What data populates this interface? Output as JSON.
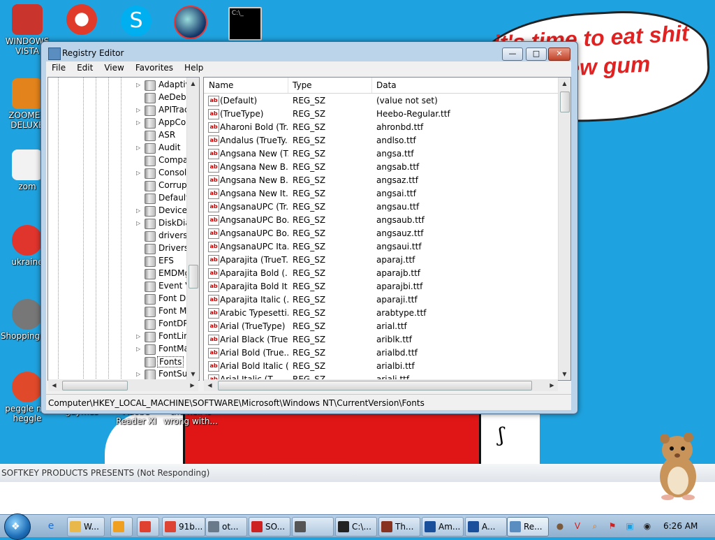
{
  "speech_bubble": {
    "text": "it's time to eat shit and chew gum"
  },
  "desktop_icons": [
    {
      "label": "WINDOWS VISTA",
      "color": "#c9342d",
      "icon": "windows-vista-icon"
    },
    {
      "label": "ZOOMER DELUXE",
      "color": "#e3831b",
      "icon": "zoomer-icon"
    },
    {
      "label": "zom",
      "color": "#f2f2f2",
      "icon": "flower-icon"
    },
    {
      "label": "ukraine",
      "color": "#e0352d",
      "icon": "radiation-icon"
    },
    {
      "label": "ShoppingC...",
      "color": "#777777",
      "icon": "flash-icon"
    },
    {
      "label": "peggle my heggle",
      "color": "#e04a2a",
      "icon": "peggle-icon"
    },
    {
      "label": "gaymes",
      "color": "#ffffff",
      "icon": "folder-icon"
    },
    {
      "label": "Adobe Reader XI",
      "color": "#ffffff",
      "icon": "adobe-icon"
    },
    {
      "label": "the hell is wrong with...",
      "color": "#ffffff",
      "icon": "file-icon"
    }
  ],
  "top_icons": [
    "peggle-icon",
    "skype-icon",
    "globe-icon",
    "cmd-icon"
  ],
  "window": {
    "title": "Registry Editor",
    "controls": {
      "minimize": "—",
      "maximize": "□",
      "close": "✕"
    },
    "menu": [
      "File",
      "Edit",
      "View",
      "Favorites",
      "Help"
    ],
    "tree": [
      {
        "label": "Adaptiv",
        "expander": "▷"
      },
      {
        "label": "AeDebu",
        "expander": ""
      },
      {
        "label": "APITrac",
        "expander": "▷"
      },
      {
        "label": "AppCo",
        "expander": "▷"
      },
      {
        "label": "ASR",
        "expander": ""
      },
      {
        "label": "Audit",
        "expander": "▷"
      },
      {
        "label": "Compa",
        "expander": ""
      },
      {
        "label": "Consol",
        "expander": "▷"
      },
      {
        "label": "Corrupt",
        "expander": ""
      },
      {
        "label": "Default",
        "expander": ""
      },
      {
        "label": "DeviceD",
        "expander": "▷"
      },
      {
        "label": "DiskDia",
        "expander": "▷"
      },
      {
        "label": "drivers.",
        "expander": ""
      },
      {
        "label": "Drivers3",
        "expander": ""
      },
      {
        "label": "EFS",
        "expander": ""
      },
      {
        "label": "EMDMg",
        "expander": ""
      },
      {
        "label": "Event V",
        "expander": ""
      },
      {
        "label": "Font Dr",
        "expander": ""
      },
      {
        "label": "Font M",
        "expander": ""
      },
      {
        "label": "FontDP",
        "expander": ""
      },
      {
        "label": "FontLin",
        "expander": "▷"
      },
      {
        "label": "FontMa",
        "expander": "▷"
      },
      {
        "label": "Fonts",
        "expander": "",
        "selected": true
      },
      {
        "label": "FontSu",
        "expander": "▷"
      }
    ],
    "columns": [
      "Name",
      "Type",
      "Data"
    ],
    "values": [
      {
        "name": "(Default)",
        "type": "REG_SZ",
        "data": "(value not set)"
      },
      {
        "name": "(TrueType)",
        "type": "REG_SZ",
        "data": "Heebo-Regular.ttf"
      },
      {
        "name": "Aharoni Bold (Tr...",
        "type": "REG_SZ",
        "data": "ahronbd.ttf"
      },
      {
        "name": "Andalus (TrueTy...",
        "type": "REG_SZ",
        "data": "andlso.ttf"
      },
      {
        "name": "Angsana New (T...",
        "type": "REG_SZ",
        "data": "angsa.ttf"
      },
      {
        "name": "Angsana New B...",
        "type": "REG_SZ",
        "data": "angsab.ttf"
      },
      {
        "name": "Angsana New B...",
        "type": "REG_SZ",
        "data": "angsaz.ttf"
      },
      {
        "name": "Angsana New It...",
        "type": "REG_SZ",
        "data": "angsai.ttf"
      },
      {
        "name": "AngsanaUPC (Tr...",
        "type": "REG_SZ",
        "data": "angsau.ttf"
      },
      {
        "name": "AngsanaUPC Bo...",
        "type": "REG_SZ",
        "data": "angsaub.ttf"
      },
      {
        "name": "AngsanaUPC Bo...",
        "type": "REG_SZ",
        "data": "angsauz.ttf"
      },
      {
        "name": "AngsanaUPC Ita...",
        "type": "REG_SZ",
        "data": "angsaui.ttf"
      },
      {
        "name": "Aparajita (TrueT...",
        "type": "REG_SZ",
        "data": "aparaj.ttf"
      },
      {
        "name": "Aparajita Bold (...",
        "type": "REG_SZ",
        "data": "aparajb.ttf"
      },
      {
        "name": "Aparajita Bold It...",
        "type": "REG_SZ",
        "data": "aparajbi.ttf"
      },
      {
        "name": "Aparajita Italic (...",
        "type": "REG_SZ",
        "data": "aparaji.ttf"
      },
      {
        "name": "Arabic Typesetti...",
        "type": "REG_SZ",
        "data": "arabtype.ttf"
      },
      {
        "name": "Arial (TrueType)",
        "type": "REG_SZ",
        "data": "arial.ttf"
      },
      {
        "name": "Arial Black (True...",
        "type": "REG_SZ",
        "data": "ariblk.ttf"
      },
      {
        "name": "Arial Bold (True...",
        "type": "REG_SZ",
        "data": "arialbd.ttf"
      },
      {
        "name": "Arial Bold Italic (...",
        "type": "REG_SZ",
        "data": "arialbi.ttf"
      },
      {
        "name": "Arial Italic (T...",
        "type": "REG_SZ",
        "data": "ariali.ttf"
      }
    ],
    "status_path": "Computer\\HKEY_LOCAL_MACHINE\\SOFTWARE\\Microsoft\\Windows NT\\CurrentVersion\\Fonts"
  },
  "not_responding_title": "SOFTKEY PRODUCTS PRESENTS (Not Responding)",
  "taskbar": {
    "quick_launch": [
      {
        "icon": "internet-explorer-icon",
        "glyph": "e",
        "color": "#1e6fd0"
      },
      {
        "icon": "explorer-folder-icon",
        "glyph": "▤",
        "color": "#d9a42b"
      }
    ],
    "buttons": [
      {
        "label": "W...",
        "icon": "explorer-icon",
        "color": "#e8b84a"
      },
      {
        "label": "",
        "icon": "media-player-icon",
        "color": "#f0a020"
      },
      {
        "label": "",
        "icon": "paint-icon",
        "color": "#e04030"
      },
      {
        "label": "91b...",
        "icon": "chrome-icon",
        "color": "#dd4433"
      },
      {
        "label": "ot...",
        "icon": "window-icon",
        "color": "#6a7a8a"
      },
      {
        "label": "SO...",
        "icon": "softkey-icon",
        "color": "#cc2222"
      },
      {
        "label": "",
        "icon": "printer-icon",
        "color": "#555555"
      },
      {
        "label": "C:\\...",
        "icon": "cmd-icon",
        "color": "#222222"
      },
      {
        "label": "Th...",
        "icon": "document-icon",
        "color": "#883322"
      },
      {
        "label": "Am...",
        "icon": "triangle-icon",
        "color": "#1a4f9c"
      },
      {
        "label": "A...",
        "icon": "triangle-icon",
        "color": "#1a4f9c"
      },
      {
        "label": "Re...",
        "icon": "regedit-icon",
        "color": "#5a8ec0"
      }
    ],
    "tray": [
      {
        "icon": "hamster-tray-icon",
        "glyph": "●",
        "color": "#7a5a3a"
      },
      {
        "icon": "v-tray-icon",
        "glyph": "V",
        "color": "#d02020"
      },
      {
        "icon": "search-tray-icon",
        "glyph": "⌕",
        "color": "#e07010"
      },
      {
        "icon": "flag-tray-icon",
        "glyph": "⚑",
        "color": "#d02020"
      },
      {
        "icon": "monitor-tray-icon",
        "glyph": "▣",
        "color": "#1aa0e0"
      },
      {
        "icon": "volume-tray-icon",
        "glyph": "◉",
        "color": "#222222"
      }
    ],
    "clock": "6:26 AM"
  }
}
